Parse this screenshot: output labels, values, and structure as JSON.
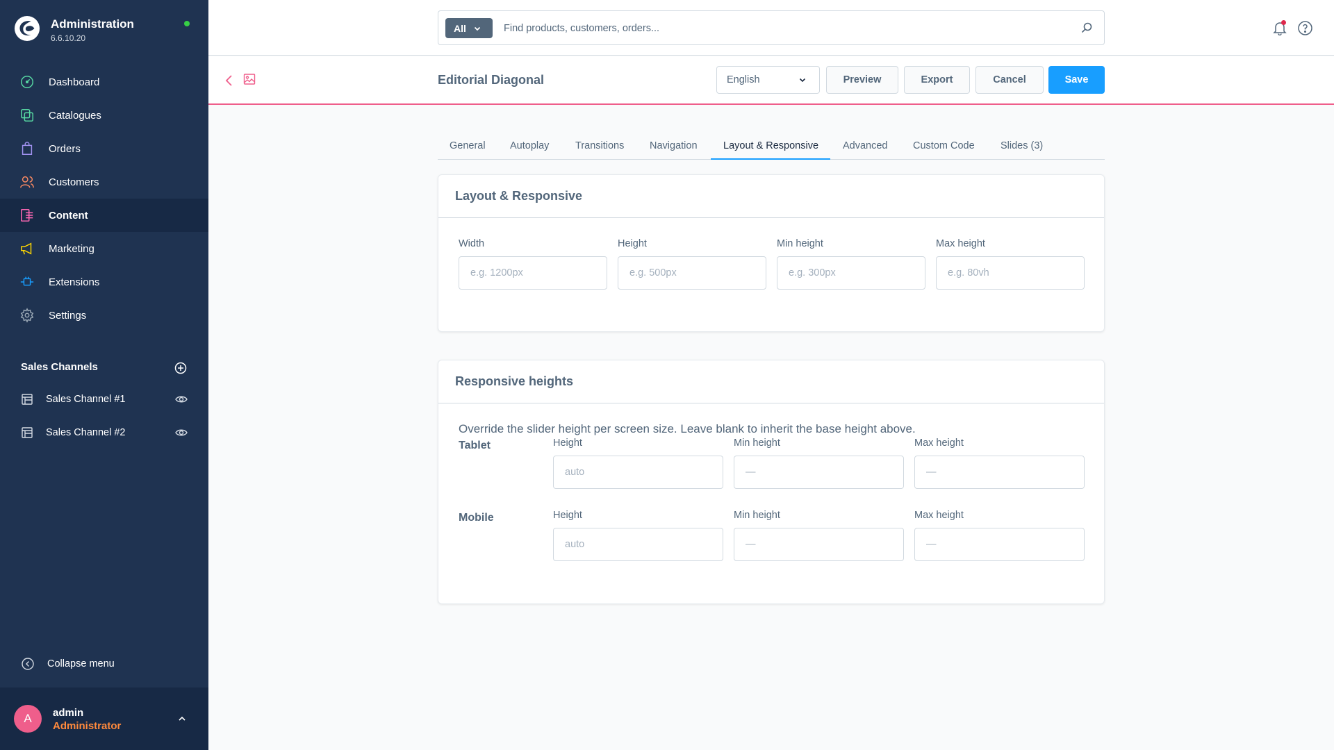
{
  "app": {
    "title": "Administration",
    "version": "6.6.10.20",
    "brand_color": "#189eff",
    "status_color": "#37d046"
  },
  "sidebar": {
    "items": [
      {
        "label": "Dashboard",
        "icon": "dashboard-icon",
        "color": "#57d9a3"
      },
      {
        "label": "Catalogues",
        "icon": "catalogue-icon",
        "color": "#57d9a3"
      },
      {
        "label": "Orders",
        "icon": "orders-icon",
        "color": "#a092f0"
      },
      {
        "label": "Customers",
        "icon": "customers-icon",
        "color": "#f88962"
      },
      {
        "label": "Content",
        "icon": "content-icon",
        "color": "#ff68b4"
      },
      {
        "label": "Marketing",
        "icon": "marketing-icon",
        "color": "#ffd700"
      },
      {
        "label": "Extensions",
        "icon": "extensions-icon",
        "color": "#189eff"
      },
      {
        "label": "Settings",
        "icon": "settings-icon",
        "color": "#9aa8b5"
      }
    ],
    "active_item": "Content",
    "sales_channels": {
      "title": "Sales Channels",
      "items": [
        {
          "label": "Sales Channel #1"
        },
        {
          "label": "Sales Channel #2"
        }
      ]
    },
    "collapse_label": "Collapse menu",
    "user": {
      "initial": "A",
      "name": "admin",
      "role": "Administrator"
    }
  },
  "search": {
    "type_label": "All",
    "placeholder": "Find products, customers, orders..."
  },
  "smartbar": {
    "title": "Editorial Diagonal",
    "language": "English",
    "preview_label": "Preview",
    "export_label": "Export",
    "cancel_label": "Cancel",
    "save_label": "Save"
  },
  "tabs": [
    {
      "label": "General"
    },
    {
      "label": "Autoplay"
    },
    {
      "label": "Transitions"
    },
    {
      "label": "Navigation"
    },
    {
      "label": "Layout & Responsive"
    },
    {
      "label": "Advanced"
    },
    {
      "label": "Custom Code"
    },
    {
      "label": "Slides (3)"
    }
  ],
  "active_tab": "Layout & Responsive",
  "layout_card": {
    "title": "Layout & Responsive",
    "fields": [
      {
        "label": "Width",
        "value": "",
        "placeholder": "e.g. 1200px"
      },
      {
        "label": "Height",
        "value": "",
        "placeholder": "e.g. 500px"
      },
      {
        "label": "Min height",
        "value": "",
        "placeholder": "e.g. 300px"
      },
      {
        "label": "Max height",
        "value": "",
        "placeholder": "e.g. 80vh"
      }
    ]
  },
  "responsive_card": {
    "title": "Responsive heights",
    "description": "Override the slider height per screen size. Leave blank to inherit the base height above.",
    "rows": [
      {
        "label": "Tablet",
        "fields": [
          {
            "label": "Height",
            "value": "",
            "placeholder": "auto"
          },
          {
            "label": "Min height",
            "value": "",
            "placeholder": "—"
          },
          {
            "label": "Max height",
            "value": "",
            "placeholder": "—"
          }
        ]
      },
      {
        "label": "Mobile",
        "fields": [
          {
            "label": "Height",
            "value": "",
            "placeholder": "auto"
          },
          {
            "label": "Min height",
            "value": "",
            "placeholder": "—"
          },
          {
            "label": "Max height",
            "value": "",
            "placeholder": "—"
          }
        ]
      }
    ]
  }
}
